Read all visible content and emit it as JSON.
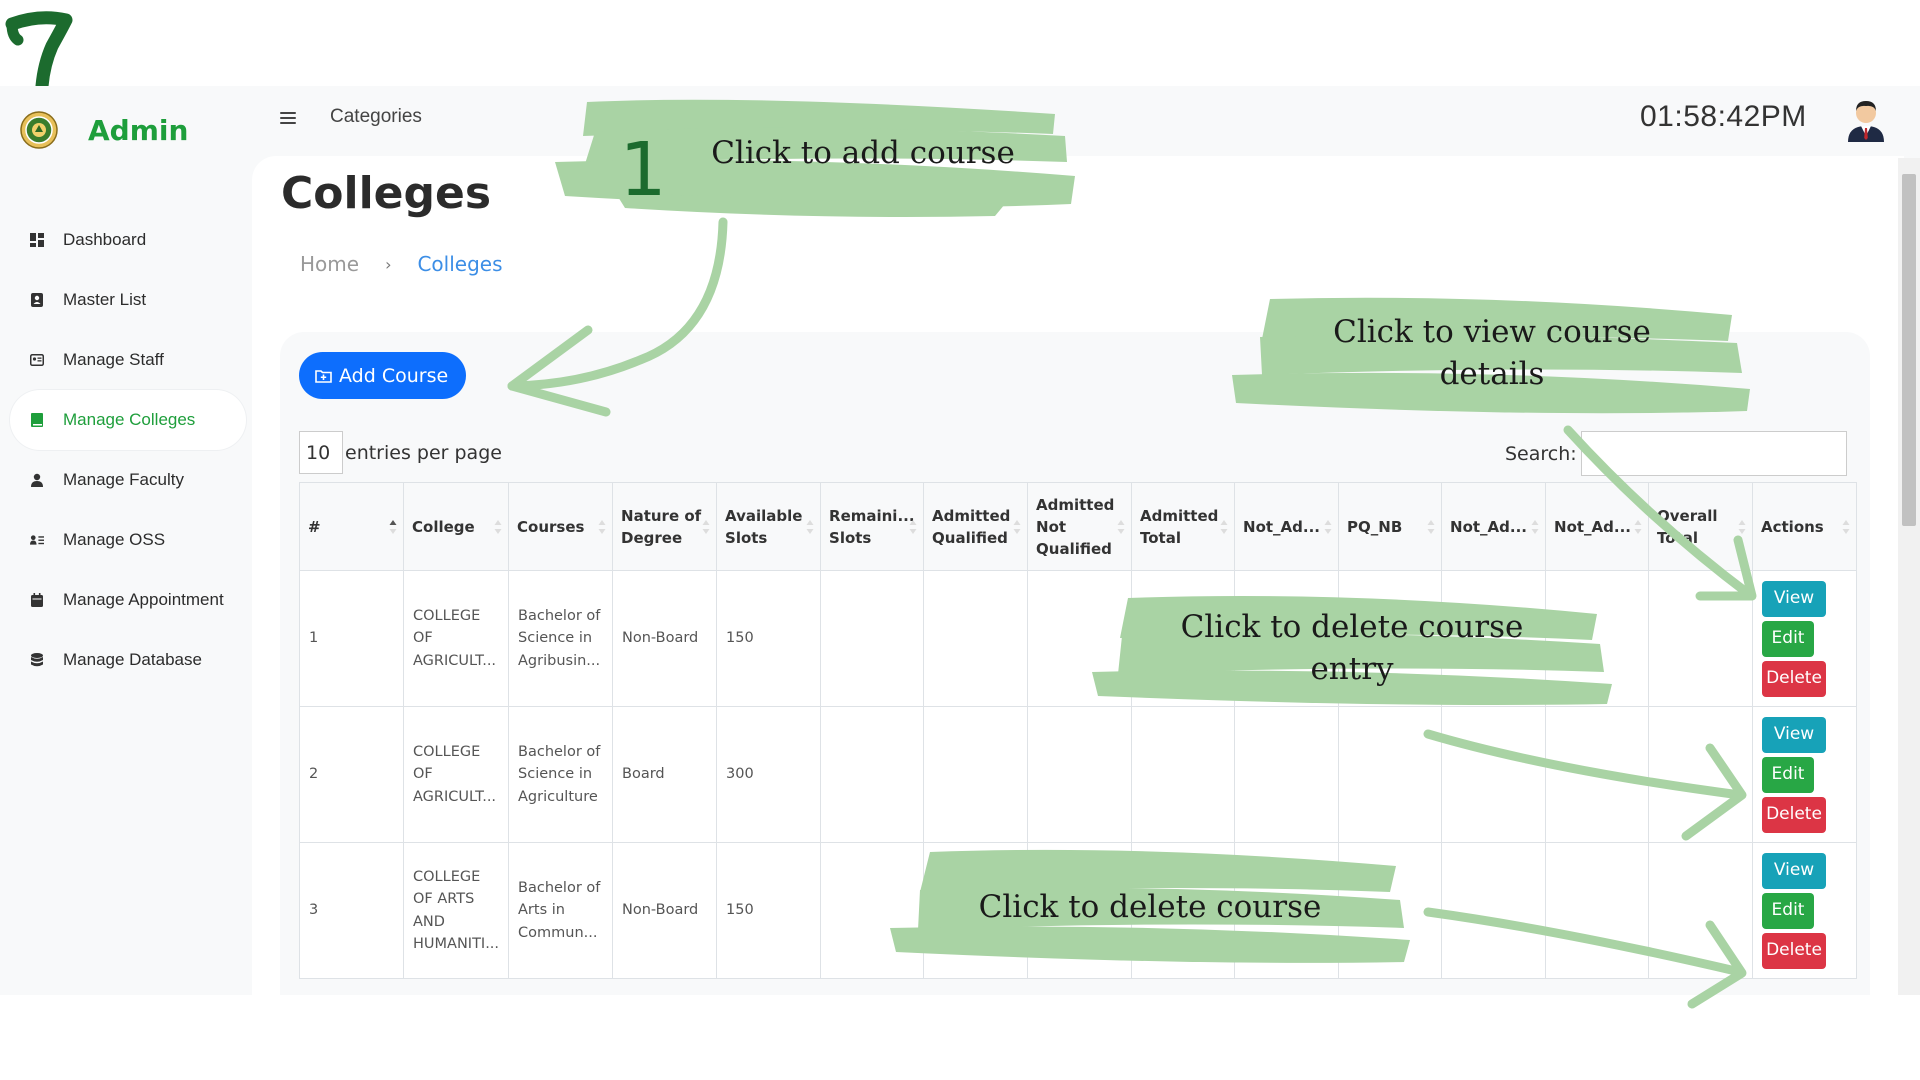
{
  "step_number": "7",
  "app": {
    "brand_name": "Admin",
    "topbar": {
      "category": "Categories",
      "clock": "01:58:42PM"
    },
    "sidebar": {
      "items": [
        {
          "label": "Dashboard",
          "icon": "dashboard-icon",
          "active": false
        },
        {
          "label": "Master List",
          "icon": "contact-book-icon",
          "active": false
        },
        {
          "label": "Manage Staff",
          "icon": "id-card-icon",
          "active": false
        },
        {
          "label": "Manage Colleges",
          "icon": "book-icon",
          "active": true
        },
        {
          "label": "Manage Faculty",
          "icon": "user-tie-icon",
          "active": false
        },
        {
          "label": "Manage OSS",
          "icon": "user-list-icon",
          "active": false
        },
        {
          "label": "Manage Appointment",
          "icon": "calendar-icon",
          "active": false
        },
        {
          "label": "Manage Database",
          "icon": "database-icon",
          "active": false
        }
      ]
    },
    "main": {
      "title": "Colleges",
      "breadcrumb": {
        "home": "Home",
        "separator": "›",
        "current": "Colleges"
      },
      "add_button": "Add Course",
      "entries": {
        "value": "10",
        "label": "entries per page"
      },
      "search_label": "Search:",
      "table": {
        "headers": [
          "#",
          "College",
          "Courses",
          "Nature of Degree",
          "Available Slots",
          "Remaini... Slots",
          "Admitted Qualified",
          "Admitted Not Qualified",
          "Admitted Total",
          "Not_Ad...",
          "PQ_NB",
          "Not_Ad...",
          "Not_Ad...",
          "Overall Total",
          "Actions"
        ],
        "rows": [
          {
            "num": "1",
            "college": "COLLEGE OF AGRICULT...",
            "course": "Bachelor of Science in Agribusin...",
            "nature": "Non-Board",
            "slots": "150"
          },
          {
            "num": "2",
            "college": "COLLEGE OF AGRICULT...",
            "course": "Bachelor of Science in Agriculture",
            "nature": "Board",
            "slots": "300"
          },
          {
            "num": "3",
            "college": "COLLEGE OF ARTS AND HUMANITI...",
            "course": "Bachelor of Arts in Commun...",
            "nature": "Non-Board",
            "slots": "150"
          }
        ],
        "actions": {
          "view": "View",
          "edit": "Edit",
          "delete": "Delete"
        }
      }
    }
  },
  "annotations": {
    "add_number": "1",
    "add_course": "Click to add course",
    "view_details": "Click to view course details",
    "delete_entry": "Click to delete course entry",
    "delete_course": "Click to delete course"
  },
  "colors": {
    "brand_green": "#1e9e3b",
    "primary_blue": "#0d6efd",
    "view_teal": "#17a2b8",
    "edit_green": "#28a745",
    "delete_red": "#dc3545",
    "annotation_green": "#a9d3a4"
  }
}
